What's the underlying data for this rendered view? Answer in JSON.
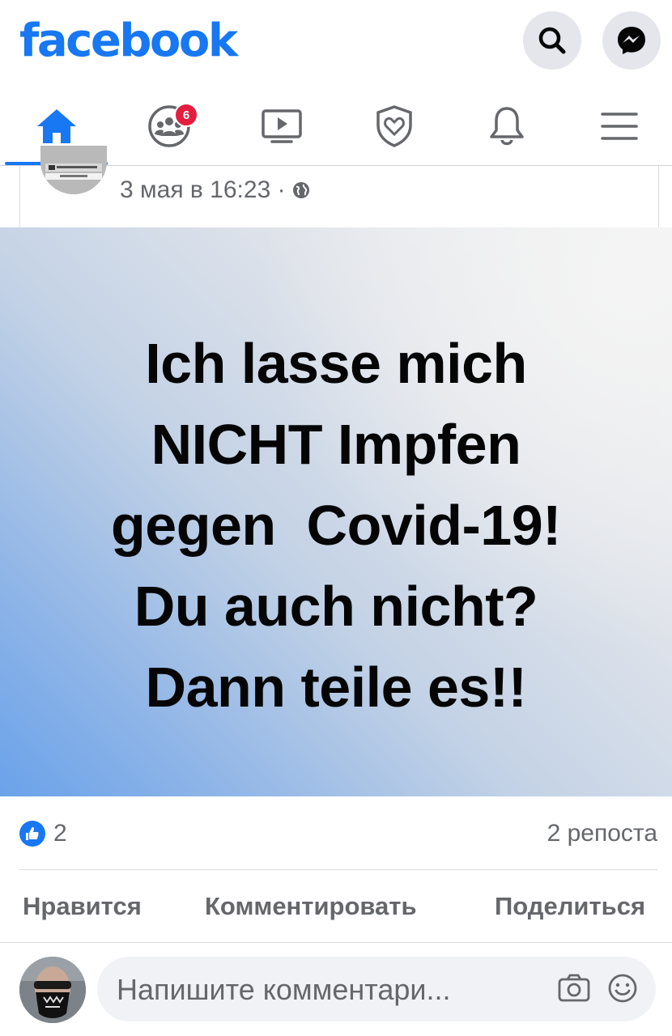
{
  "header": {
    "logo": "facebook",
    "search_icon": "search-icon",
    "messenger_icon": "messenger-icon"
  },
  "nav": {
    "tabs": [
      {
        "name": "home",
        "icon": "home-icon",
        "active": true
      },
      {
        "name": "groups",
        "icon": "groups-icon",
        "badge": "6"
      },
      {
        "name": "watch",
        "icon": "video-icon"
      },
      {
        "name": "dating",
        "icon": "shield-heart-icon"
      },
      {
        "name": "notifications",
        "icon": "bell-icon"
      },
      {
        "name": "menu",
        "icon": "hamburger-icon"
      }
    ]
  },
  "post": {
    "timestamp": "3 мая в 16:23 ·",
    "privacy_icon": "globe-icon",
    "image_text": {
      "line1": "Ich lasse mich",
      "line2": "NICHT Impfen",
      "line3": "gegen  Covid-19!",
      "line4": "Du auch nicht?",
      "line5": "Dann teile es!!"
    },
    "like_count": "2",
    "share_count": "2 репоста"
  },
  "actions": {
    "like": "Нравится",
    "comment": "Комментировать",
    "share": "Поделиться"
  },
  "comment_input": {
    "placeholder": "Напишите комментари..."
  },
  "colors": {
    "brand": "#1877f2",
    "badge": "#e41e3f",
    "muted_text": "#65676b",
    "input_bg": "#f0f2f5"
  }
}
